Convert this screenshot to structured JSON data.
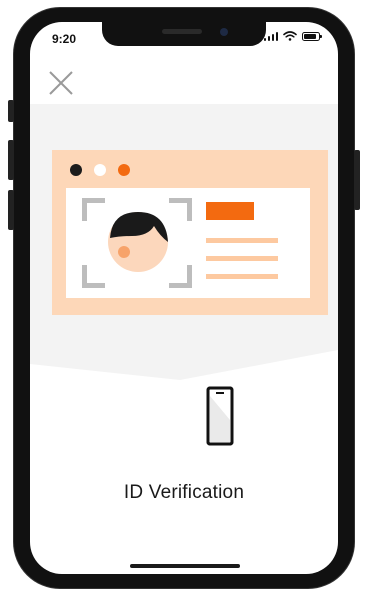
{
  "status_bar": {
    "time": "9:20",
    "icons": [
      "signal-icon",
      "wifi-icon",
      "battery-icon"
    ]
  },
  "header": {
    "close_icon": "close-icon"
  },
  "illustration": {
    "card_dots_colors": [
      "#1c1c1c",
      "#ffffff",
      "#f36a10"
    ],
    "accent_color": "#f36a10",
    "card_color": "#fdd7b8",
    "line_color": "#fdc9a0"
  },
  "main": {
    "title": "ID Verification",
    "device_icon": "phone-icon"
  }
}
